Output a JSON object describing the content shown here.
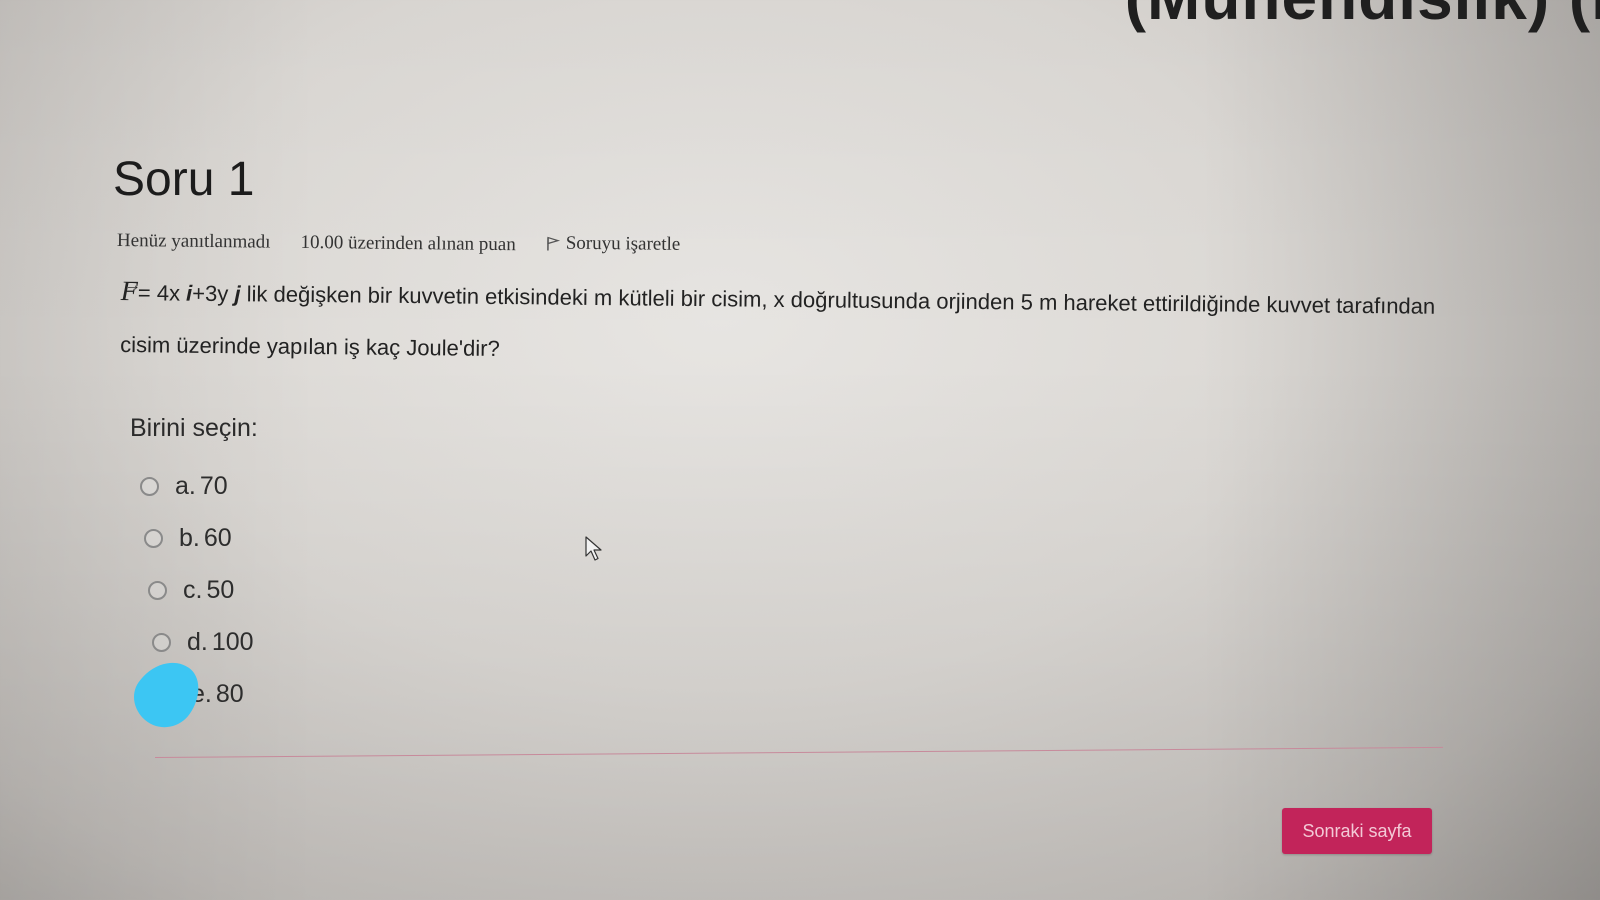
{
  "page": {
    "top_title_fragment": "(Mühendislik) (I",
    "question_title": "Soru 1"
  },
  "question_info": {
    "status": "Henüz yanıtlanmadı",
    "grade": "10.00 üzerinden alınan puan",
    "flag_label": "Soruyu işaretle"
  },
  "question": {
    "vector_symbol": "F",
    "formula_prefix": "= 4x ",
    "unit_i": "i",
    "formula_middle": "+3y ",
    "unit_j": "j",
    "text": " lik değişken bir kuvvetin etkisindeki m kütleli bir cisim, x doğrultusunda orjinden 5 m hareket ettirildiğinde kuvvet tarafından cisim üzerinde yapılan iş kaç Joule'dir?"
  },
  "answer": {
    "prompt": "Birini seçin:",
    "options": [
      {
        "letter": "a.",
        "value": "70"
      },
      {
        "letter": "b.",
        "value": "60"
      },
      {
        "letter": "c.",
        "value": "50"
      },
      {
        "letter": "d.",
        "value": "100"
      },
      {
        "letter": "e.",
        "value": "80"
      }
    ]
  },
  "navigation": {
    "next_label": "Sonraki sayfa"
  },
  "colors": {
    "accent": "#c2245a",
    "overlay_blob": "#3cc6f3",
    "separator": "#c78a9b"
  },
  "icons": {
    "flag": "flag-icon",
    "cursor": "mouse-pointer-icon",
    "radio": "radio-button"
  }
}
